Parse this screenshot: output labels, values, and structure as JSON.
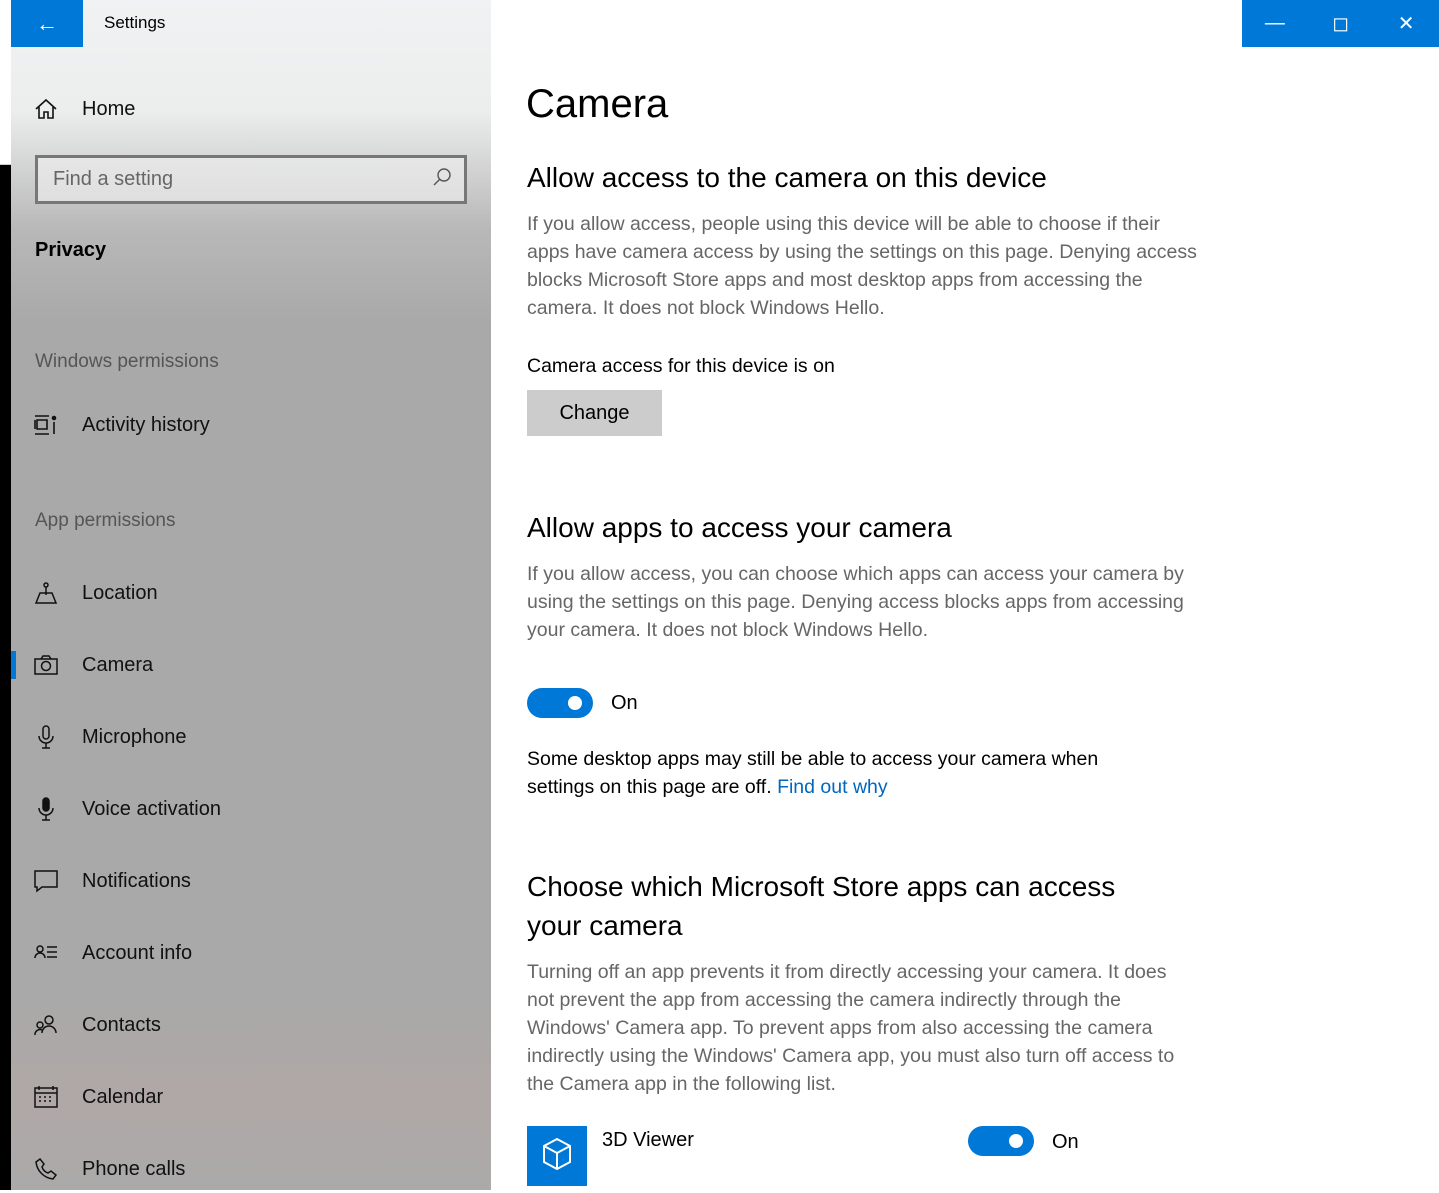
{
  "window": {
    "title": "Settings",
    "back_icon": "back-arrow-icon",
    "controls": [
      "minimize-icon",
      "maximize-icon",
      "close-icon"
    ]
  },
  "colors": {
    "accent": "#0078d7",
    "link": "#0067c0"
  },
  "sidebar": {
    "home": "Home",
    "search_placeholder": "Find a setting",
    "section": "Privacy",
    "windows_permissions": "Windows permissions",
    "activity": "Activity history",
    "app_permissions": "App permissions",
    "items": [
      {
        "label": "Location",
        "icon": "location-icon"
      },
      {
        "label": "Camera",
        "icon": "camera-icon",
        "selected": true
      },
      {
        "label": "Microphone",
        "icon": "microphone-icon"
      },
      {
        "label": "Voice activation",
        "icon": "voice-activation-icon"
      },
      {
        "label": "Notifications",
        "icon": "notifications-icon"
      },
      {
        "label": "Account info",
        "icon": "account-info-icon"
      },
      {
        "label": "Contacts",
        "icon": "contacts-icon"
      },
      {
        "label": "Calendar",
        "icon": "calendar-icon"
      },
      {
        "label": "Phone calls",
        "icon": "phone-icon"
      }
    ]
  },
  "main": {
    "title": "Camera",
    "s1": {
      "heading": "Allow access to the camera on this device",
      "desc": "If you allow access, people using this device will be able to choose if their apps have camera access by using the settings on this page. Denying access blocks Microsoft Store apps and most desktop apps from accessing the camera. It does not block Windows Hello.",
      "status": "Camera access for this device is on",
      "button": "Change"
    },
    "s2": {
      "heading": "Allow apps to access your camera",
      "desc": "If you allow access, you can choose which apps can access your camera by using the settings on this page. Denying access blocks apps from accessing your camera. It does not block Windows Hello.",
      "toggle": "On",
      "note": "Some desktop apps may still be able to access your camera when settings on this page are off.",
      "link": "Find out why"
    },
    "s3": {
      "heading": "Choose which Microsoft Store apps can access your camera",
      "desc": "Turning off an app prevents it from directly accessing your camera. It does not prevent the app from accessing the camera indirectly through the Windows' Camera app. To prevent apps from also accessing the camera indirectly using the Windows' Camera app, you must also turn off access to the Camera app in the following list.",
      "apps": [
        {
          "name": "3D Viewer",
          "toggle": "On",
          "icon": "3d-cube-icon"
        }
      ]
    }
  }
}
